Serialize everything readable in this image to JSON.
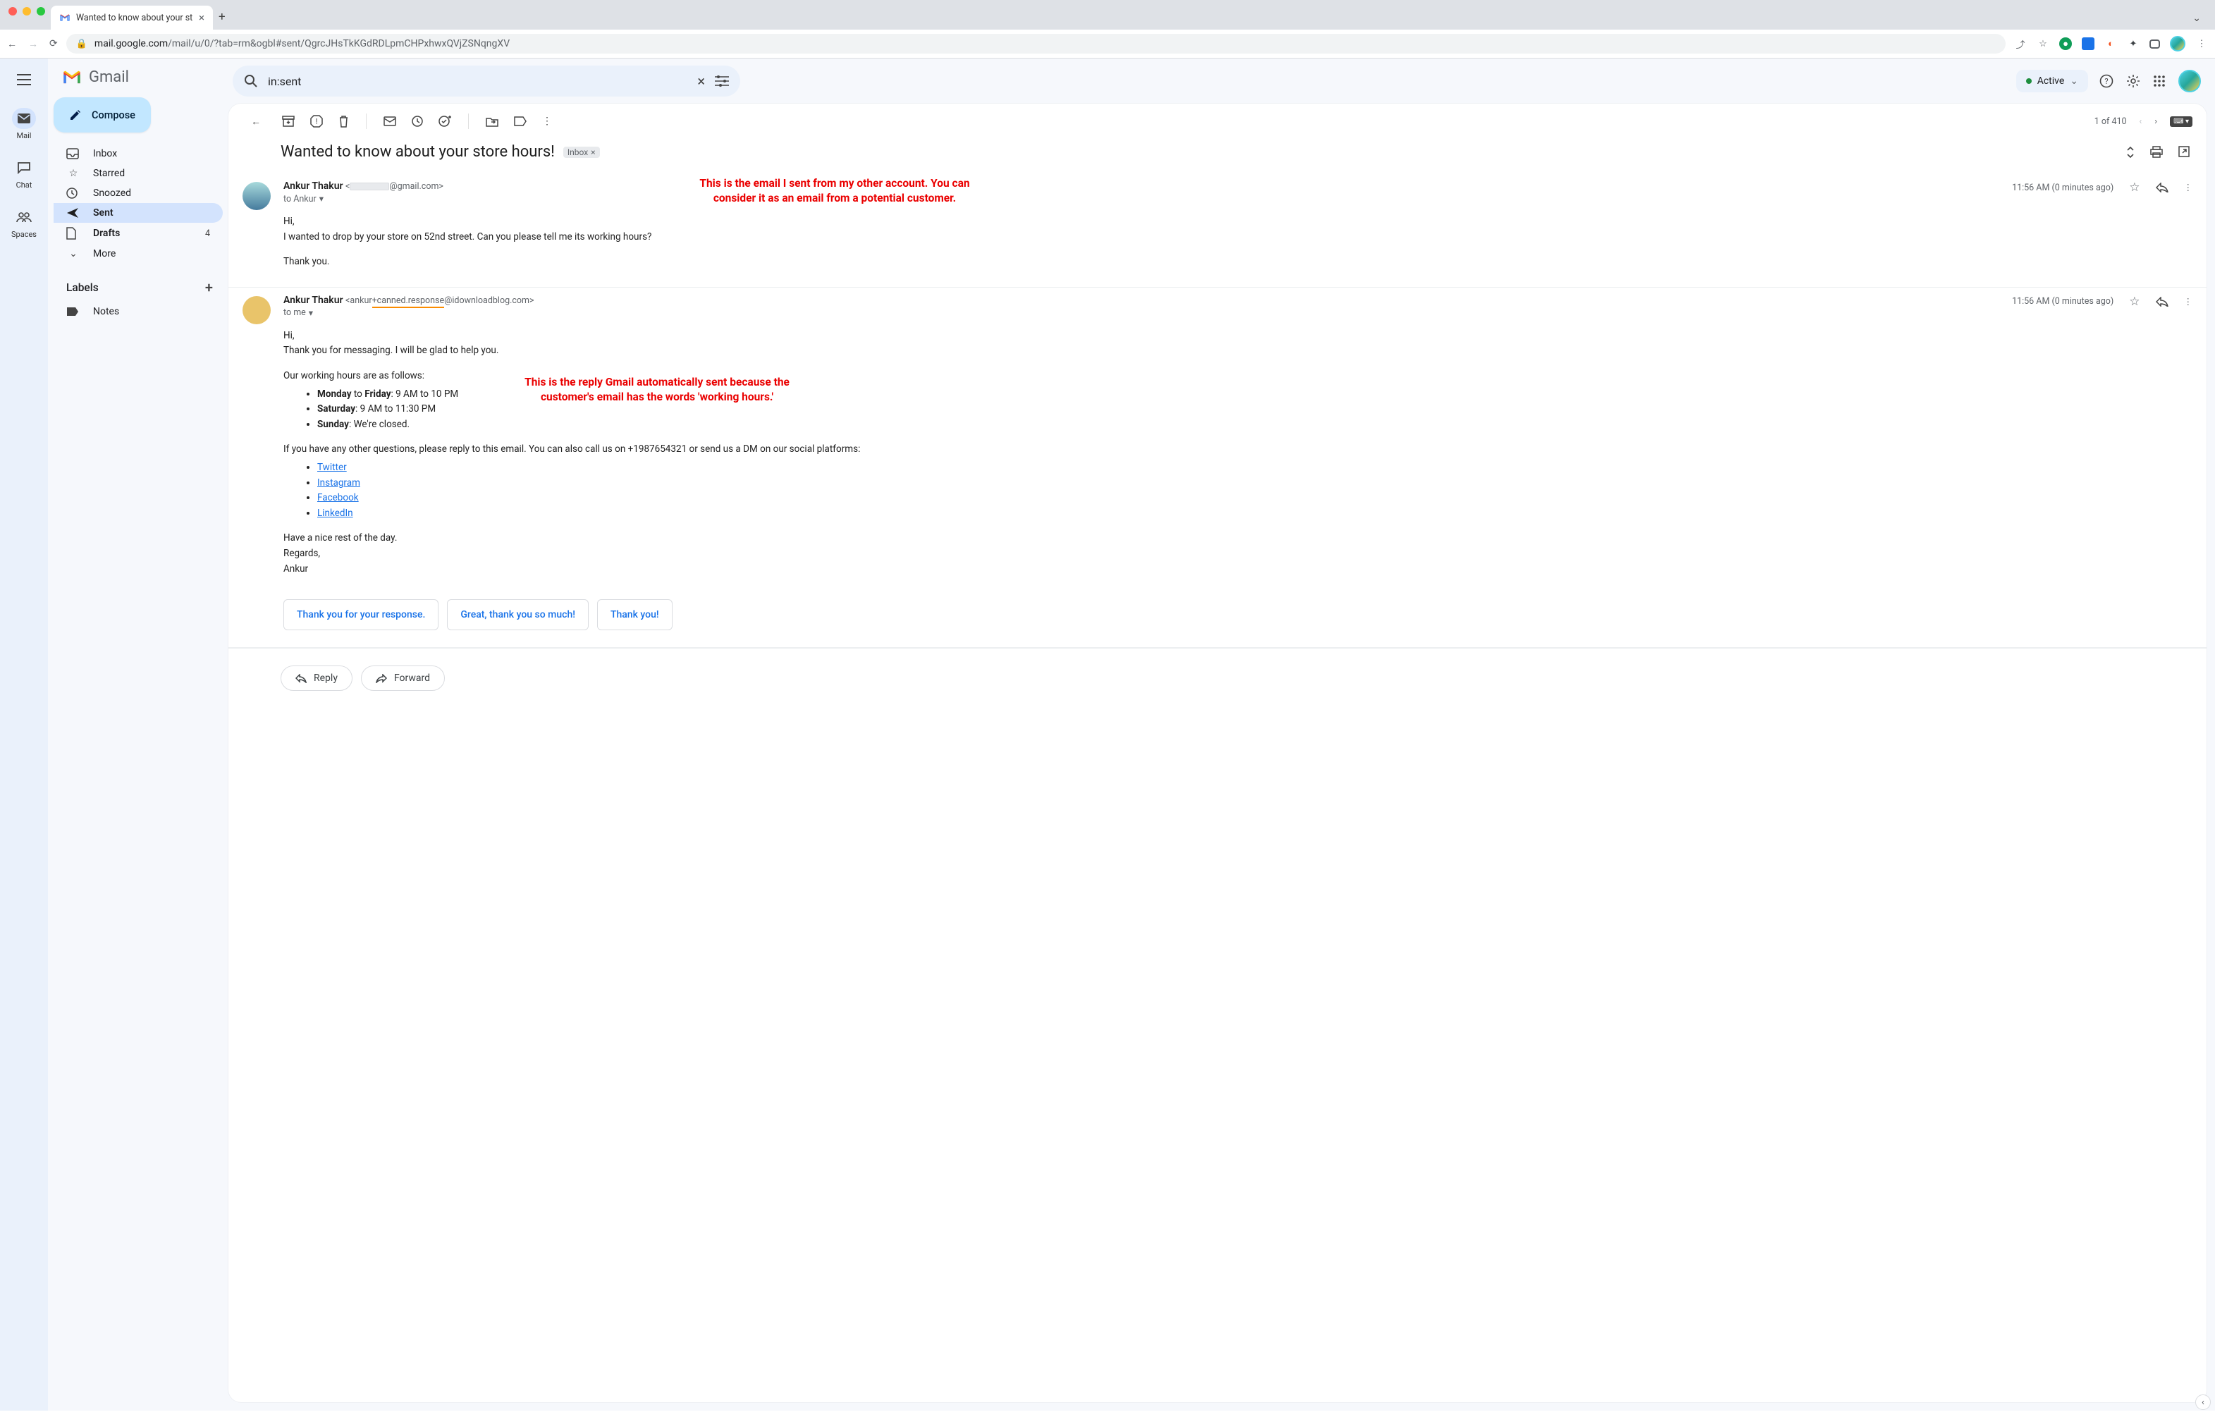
{
  "browser": {
    "tab_title": "Wanted to know about your st",
    "url_domain": "mail.google.com",
    "url_path": "/mail/u/0/?tab=rm&ogbl#sent/QgrcJHsTkKGdRDLpmCHPxhwxQVjZSNqngXV"
  },
  "gmail": {
    "logo_text": "Gmail",
    "search_value": "in:sent",
    "status": "Active",
    "compose": "Compose",
    "rail": {
      "mail": "Mail",
      "chat": "Chat",
      "spaces": "Spaces"
    },
    "nav": {
      "inbox": "Inbox",
      "starred": "Starred",
      "snoozed": "Snoozed",
      "sent": "Sent",
      "drafts": "Drafts",
      "drafts_count": "4",
      "more": "More"
    },
    "labels_header": "Labels",
    "labels": {
      "notes": "Notes"
    },
    "pagination": "1 of 410"
  },
  "thread": {
    "subject": "Wanted to know about your store hours!",
    "chip": "Inbox",
    "messages": [
      {
        "sender_name": "Ankur Thakur",
        "email_prefix": "<",
        "email_suffix": "@gmail.com>",
        "to": "to Ankur",
        "time": "11:56 AM (0 minutes ago)",
        "body_l1": "Hi,",
        "body_l2": "I wanted to drop by your store on 52nd street. Can you please tell me its working hours?",
        "body_l3": "Thank you.",
        "annotation_l1": "This is the email I sent from my other account. You can",
        "annotation_l2": "consider it as an email from a potential customer."
      },
      {
        "sender_name": "Ankur Thakur",
        "email_prefix": "<ankur",
        "email_canned": "+canned.response",
        "email_suffix": "@idownloadblog.com>",
        "to": "to me",
        "time": "11:56 AM (0 minutes ago)",
        "body_l1": "Hi,",
        "body_l2": "Thank you for messaging. I will be glad to help you.",
        "body_l3": "Our working hours are as follows:",
        "hours_mon": "Monday to Friday: 9 AM to 10 PM",
        "hours_mon_b1": "Monday",
        "hours_mon_mid": " to ",
        "hours_mon_b2": "Friday",
        "hours_mon_rest": ": 9 AM to 10 PM",
        "hours_sat_b": "Saturday",
        "hours_sat_rest": ": 9 AM to 11:30 PM",
        "hours_sun_b": "Sunday",
        "hours_sun_rest": ": We're closed.",
        "body_l4": "If you have any other questions, please reply to this email. You can also call us on +1987654321 or send us a DM on our social platforms:",
        "social": {
          "twitter": "Twitter",
          "instagram": "Instagram",
          "facebook": "Facebook",
          "linkedin": "LinkedIn"
        },
        "body_l5": "Have a nice rest of the day.",
        "body_l6": "Regards,",
        "body_l7": "Ankur",
        "annotation_l1": "This is the reply Gmail automatically sent because the",
        "annotation_l2": "customer's email has the words 'working hours.'"
      }
    ],
    "smart_replies": {
      "r1": "Thank you for your response.",
      "r2": "Great, thank you so much!",
      "r3": "Thank you!"
    },
    "reply_btn": "Reply",
    "forward_btn": "Forward"
  }
}
